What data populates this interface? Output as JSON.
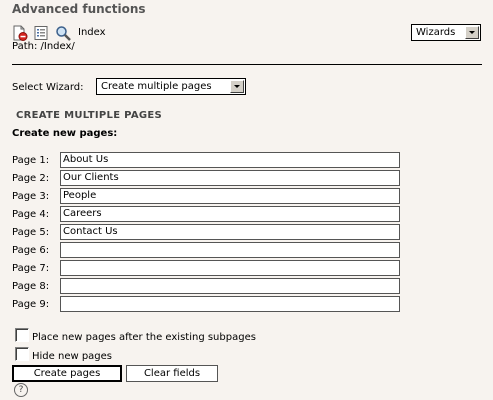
{
  "header": {
    "title": "Advanced functions",
    "index_label": "Index",
    "path": "Path: /Index/",
    "wizards_select": "Wizards"
  },
  "wizard": {
    "label": "Select Wizard:",
    "selected": "Create multiple pages"
  },
  "section": {
    "heading": "CREATE MULTIPLE PAGES",
    "subheading": "Create new pages:"
  },
  "pages": [
    {
      "label": "Page 1:",
      "value": "About Us"
    },
    {
      "label": "Page 2:",
      "value": "Our Clients"
    },
    {
      "label": "Page 3:",
      "value": "People"
    },
    {
      "label": "Page 4:",
      "value": "Careers"
    },
    {
      "label": "Page 5:",
      "value": "Contact Us"
    },
    {
      "label": "Page 6:",
      "value": ""
    },
    {
      "label": "Page 7:",
      "value": ""
    },
    {
      "label": "Page 8:",
      "value": ""
    },
    {
      "label": "Page 9:",
      "value": ""
    }
  ],
  "options": {
    "place_after_label": "Place new pages after the existing subpages",
    "hide_label": "Hide new pages"
  },
  "buttons": {
    "create": "Create pages",
    "clear": "Clear fields"
  },
  "help_glyph": "?",
  "icons": [
    "delete-page-icon",
    "list-icon",
    "magnifier-icon",
    "help-icon"
  ]
}
